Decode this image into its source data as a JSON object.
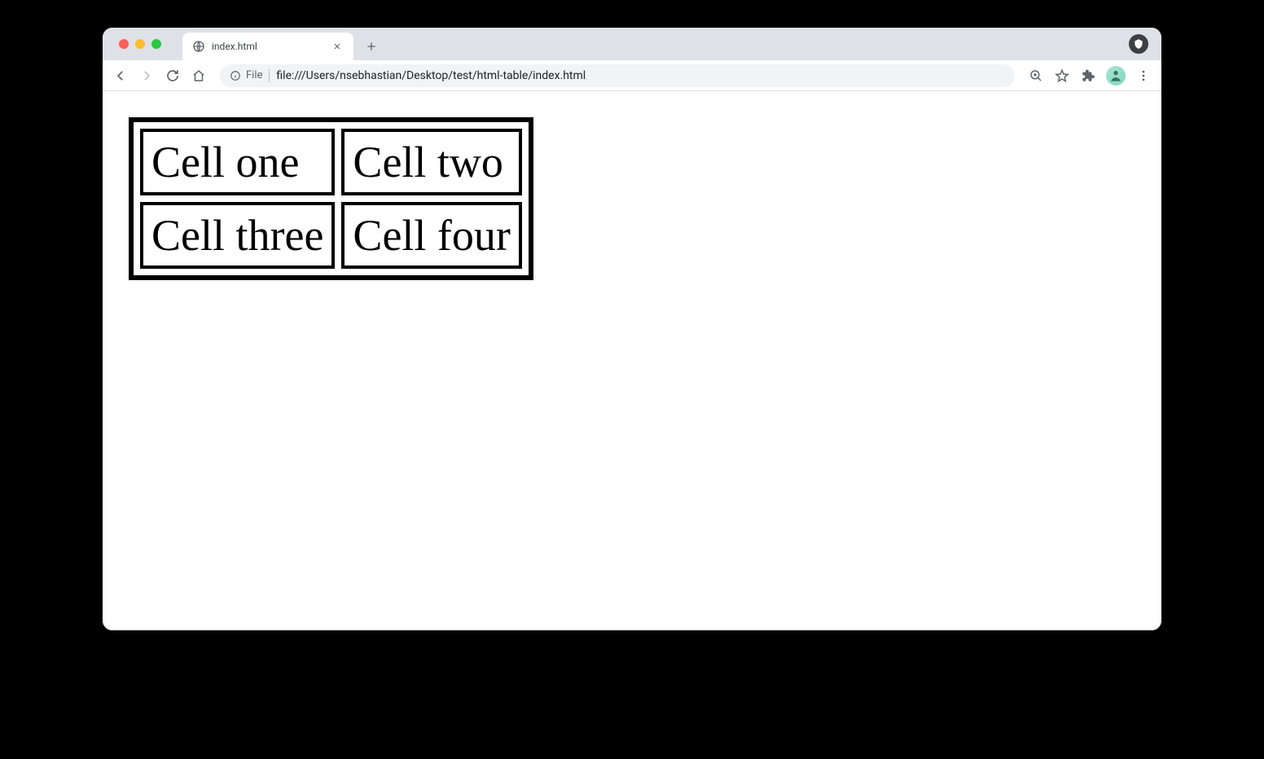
{
  "tab": {
    "title": "index.html"
  },
  "address_bar": {
    "scheme_label": "File",
    "url": "file:///Users/nsebhastian/Desktop/test/html-table/index.html"
  },
  "page": {
    "table": {
      "rows": [
        [
          "Cell one",
          "Cell two"
        ],
        [
          "Cell three",
          "Cell four"
        ]
      ]
    }
  }
}
